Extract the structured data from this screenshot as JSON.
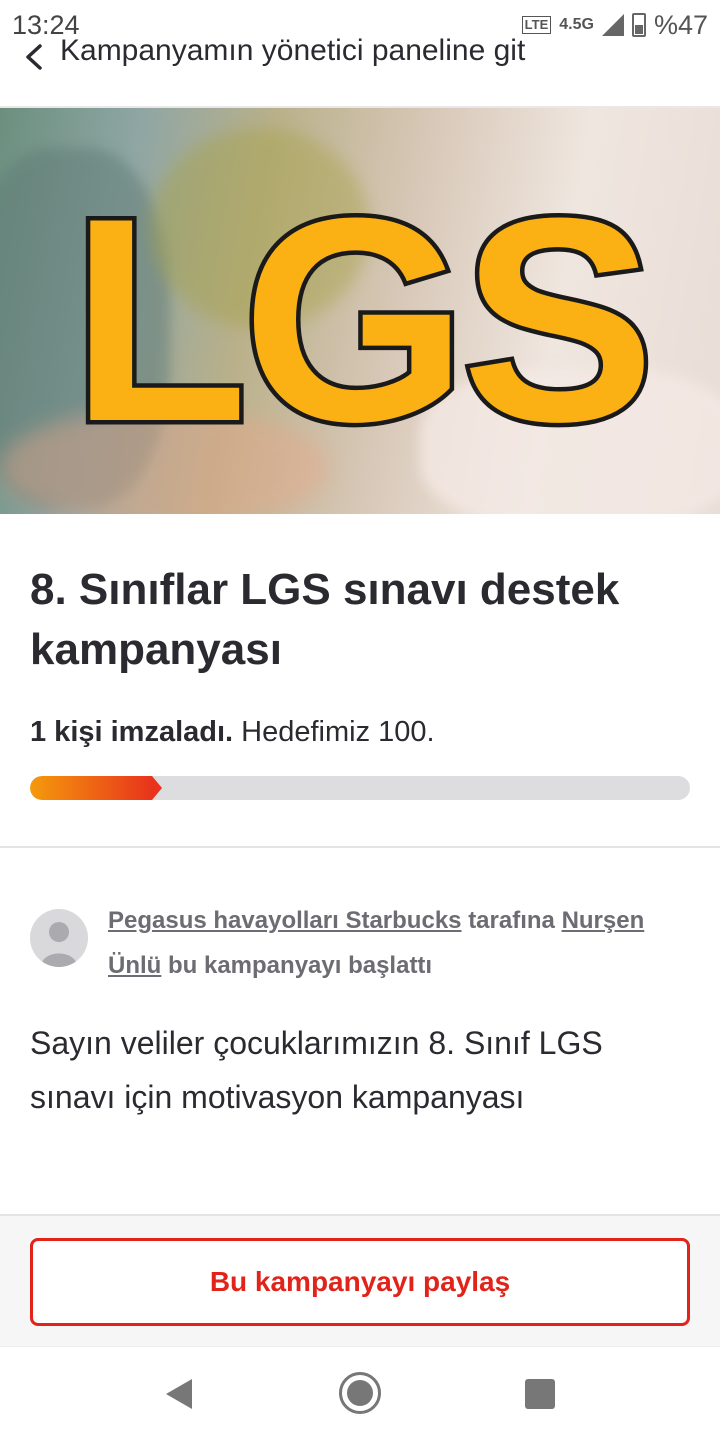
{
  "status_bar": {
    "time": "13:24",
    "network": "4.5G",
    "volte": "VoLTE",
    "battery": "%47"
  },
  "top_nav": {
    "back_label": "Kampanyamın yönetici paneline git"
  },
  "hero": {
    "logo_text": "LGS",
    "logo_color": "#FBB014"
  },
  "campaign": {
    "title": "8. Sınıflar LGS sınavı destek kampanyası",
    "signed_text": "1 kişi imzaladı.",
    "goal_text": "Hedefimiz 100.",
    "progress_fraction": 0.2,
    "starter": {
      "recipient": "Pegasus havayolları Starbucks",
      "to_word": "tarafına",
      "starter_name": "Nurşen Ünlü",
      "suffix": "bu kampanyayı başlattı"
    },
    "description": "Sayın veliler çocuklarımızın 8. Sınıf LGS sınavı için motivasyon kampanyası"
  },
  "share": {
    "button_label": "Bu kampanyayı paylaş",
    "accent": "#E2231A"
  },
  "nav_bar": {
    "back": "back-icon",
    "home": "home-icon",
    "recent": "recent-apps-icon"
  }
}
